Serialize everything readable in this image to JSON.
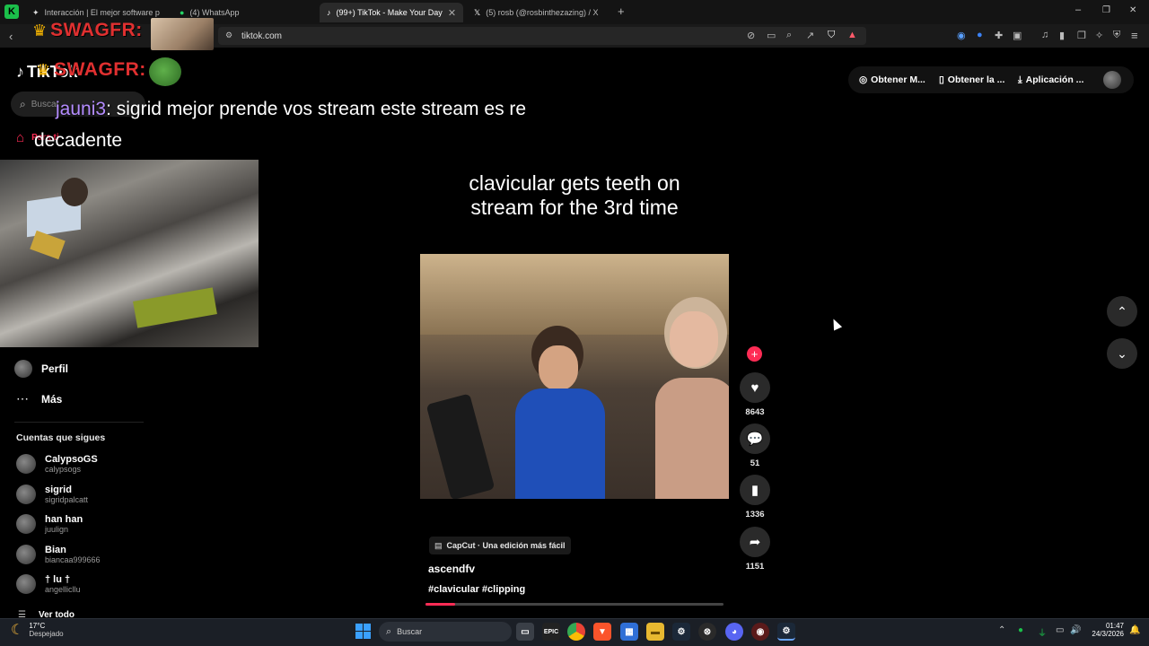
{
  "browser": {
    "tabs": [
      {
        "label": "Interacción | El mejor software para",
        "icon": "ai-tab-icon"
      },
      {
        "label": "(4) WhatsApp",
        "icon": "whatsapp-icon"
      },
      {
        "label": "(99+) TikTok - Make Your Day",
        "icon": "tiktok-icon",
        "active": true
      },
      {
        "label": "(5) rosb (@rosbinthezazing) / X",
        "icon": "x-icon"
      }
    ],
    "new_tab": "+",
    "url": "tiktok.com",
    "window_controls": {
      "minimize": "–",
      "maximize": "❐",
      "close": "✕"
    }
  },
  "overlay": {
    "badge1": "SWAGFR:",
    "badge2": "SWAGFR:",
    "chat_user": "jauni3",
    "chat_message_line1": ": sigrid mejor prende vos stream este stream es re",
    "chat_message_line2": "decadente"
  },
  "tiktok": {
    "logo": "TikTok",
    "search_placeholder": "Buscar",
    "home_label": "Para ti",
    "sidebar": {
      "profile": "Perfil",
      "more": "Más",
      "following_heading": "Cuentas que sigues",
      "following": [
        {
          "name": "CalypsoGS",
          "handle": "calypsogs"
        },
        {
          "name": "sigrid",
          "handle": "sigridpalcatt"
        },
        {
          "name": "han han",
          "handle": "juulign"
        },
        {
          "name": "Bian",
          "handle": "biancaa999666"
        },
        {
          "name": "† lu †",
          "handle": "angellicllu"
        }
      ],
      "see_all": "Ver todo"
    },
    "header_buttons": [
      {
        "label": "Obtener M...",
        "icon": "coin-icon"
      },
      {
        "label": "Obtener la ...",
        "icon": "phone-icon"
      },
      {
        "label": "Aplicación ...",
        "icon": "download-icon"
      }
    ],
    "video": {
      "caption_line1": "clavicular gets teeth on",
      "caption_line2": "stream for the 3rd time",
      "capcut_label": "CapCut · Una edición más fácil",
      "author": "ascendfv",
      "hashtags": "#clavicular #clipping",
      "progress": 0.1
    },
    "actions": {
      "likes": "8643",
      "comments": "51",
      "saves": "1336",
      "shares": "1151"
    }
  },
  "taskbar": {
    "weather_temp": "17°C",
    "weather_desc": "Despejado",
    "search_placeholder": "Buscar",
    "time": "01:47",
    "date": "24/3/2026"
  }
}
